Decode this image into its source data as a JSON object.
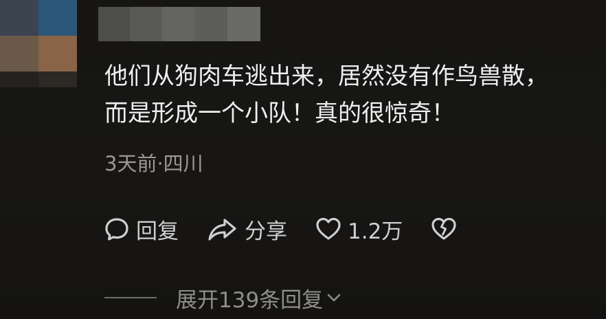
{
  "comment": {
    "line1": "他们从狗肉车逃出来，居然没有作鸟兽散，",
    "line2": "而是形成一个小队！真的很惊奇！",
    "meta": "3天前·四川"
  },
  "actions": {
    "reply_label": "回复",
    "share_label": "分享",
    "like_count": "1.2万"
  },
  "replies": {
    "expand_label": "展开139条回复"
  },
  "icons": {
    "reply": "speech-bubble-icon",
    "share": "share-arrow-icon",
    "like": "heart-icon",
    "dislike": "broken-heart-icon",
    "expand": "chevron-down-icon"
  }
}
